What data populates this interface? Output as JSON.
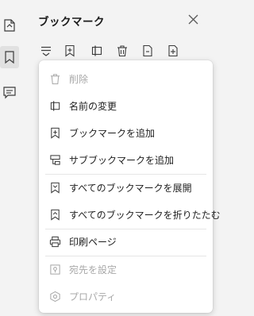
{
  "panel": {
    "title": "ブックマーク",
    "close_icon": "close-icon"
  },
  "left_rail": [
    {
      "icon": "page-thumbnail-icon",
      "active": false
    },
    {
      "icon": "bookmark-icon",
      "active": true
    },
    {
      "icon": "comment-icon",
      "active": false
    }
  ],
  "toolbar": [
    {
      "icon": "options-menu-icon"
    },
    {
      "icon": "add-bookmark-icon"
    },
    {
      "icon": "rename-icon"
    },
    {
      "icon": "delete-icon"
    },
    {
      "icon": "document-icon"
    },
    {
      "icon": "add-document-icon"
    }
  ],
  "menu": {
    "items": [
      {
        "label": "削除",
        "icon": "trash-icon",
        "disabled": true
      },
      {
        "label": "名前の変更",
        "icon": "rename-icon",
        "disabled": false
      },
      {
        "label": "ブックマークを追加",
        "icon": "add-bookmark-icon",
        "disabled": false
      },
      {
        "label": "サブブックマークを追加",
        "icon": "add-sub-bookmark-icon",
        "disabled": false
      },
      {
        "label": "すべてのブックマークを展開",
        "icon": "expand-all-icon",
        "disabled": false
      },
      {
        "label": "すべてのブックマークを折りたたむ",
        "icon": "collapse-all-icon",
        "disabled": false
      },
      {
        "label": "印刷ページ",
        "icon": "printer-icon",
        "disabled": false
      },
      {
        "label": "宛先を設定",
        "icon": "set-destination-icon",
        "disabled": true
      },
      {
        "label": "プロパティ",
        "icon": "properties-icon",
        "disabled": true
      }
    ]
  },
  "colors": {
    "icon": "#3c3c3c",
    "disabled": "#a8a8a8",
    "background": "#f3f3f3",
    "menu_background": "#ffffff"
  }
}
